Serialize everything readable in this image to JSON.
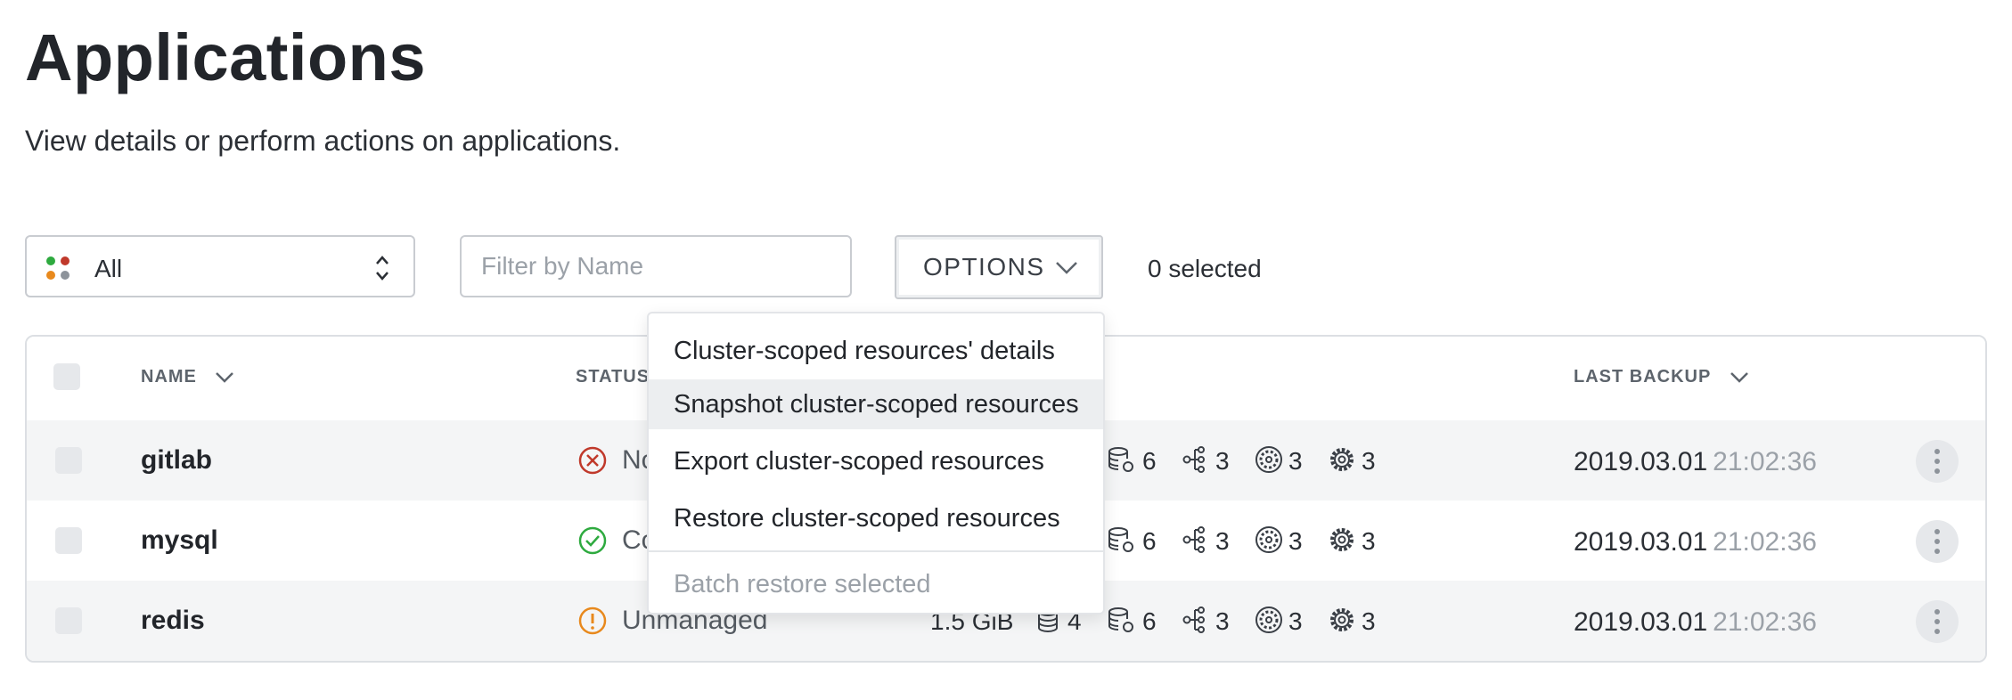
{
  "page": {
    "title": "Applications",
    "subtitle": "View details or perform actions on applications."
  },
  "toolbar": {
    "filter_select": {
      "value": "All"
    },
    "name_filter": {
      "placeholder": "Filter by Name",
      "value": ""
    },
    "options_label": "OPTIONS",
    "selected_count": "0 selected"
  },
  "table": {
    "columns": {
      "name": "NAME",
      "status": "STATUS",
      "last_backup": "LAST BACKUP"
    },
    "rows": [
      {
        "name": "gitlab",
        "status": "No",
        "status_kind": "error",
        "size": "",
        "volumes": "",
        "snapshots": "6",
        "nodes": "3",
        "policies": "3",
        "settings": "3",
        "backup_date": "2019.03.01",
        "backup_time": "21:02:36"
      },
      {
        "name": "mysql",
        "status": "Co",
        "status_kind": "ok",
        "size": "",
        "volumes": "",
        "snapshots": "6",
        "nodes": "3",
        "policies": "3",
        "settings": "3",
        "backup_date": "2019.03.01",
        "backup_time": "21:02:36"
      },
      {
        "name": "redis",
        "status": "Unmanaged",
        "status_kind": "warning",
        "size": "1.5 GiB",
        "volumes": "4",
        "snapshots": "6",
        "nodes": "3",
        "policies": "3",
        "settings": "3",
        "backup_date": "2019.03.01",
        "backup_time": "21:02:36"
      }
    ]
  },
  "options_menu": {
    "items": [
      "Cluster-scoped resources' details",
      "Snapshot cluster-scoped resources",
      "Export cluster-scoped resources",
      "Restore cluster-scoped resources"
    ],
    "highlighted_index": 1,
    "disabled_item": "Batch restore selected"
  },
  "colors": {
    "error": "#c0392b",
    "ok": "#2eaa3f",
    "warning": "#e8891d",
    "dot_green": "#2eaa3f",
    "dot_red": "#c0392b",
    "dot_orange": "#e8891d",
    "dot_gray": "#8d939a"
  },
  "icons": [
    "select-updown-icon",
    "chevron-down-icon",
    "error-circle-icon",
    "check-circle-icon",
    "warning-circle-icon",
    "database-icon",
    "database-snapshot-icon",
    "node-tree-icon",
    "policy-gear-icon",
    "gear-icon",
    "kebab-menu-icon"
  ]
}
